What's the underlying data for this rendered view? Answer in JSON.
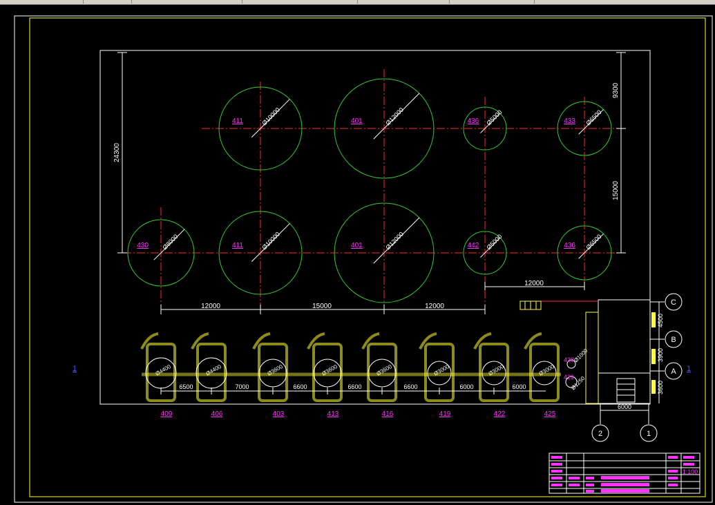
{
  "colors": {
    "background": "#000000",
    "frame": "#ffffff",
    "tank": "#33cc33",
    "centerline": "#ff2a2a",
    "label": "#ff33ff",
    "dimension": "#ffffff",
    "pipe": "#ffff33",
    "stair": "#ffff33"
  },
  "tanks": [
    {
      "tag": "411",
      "dia": "Ø10000"
    },
    {
      "tag": "401",
      "dia": "Ø12000"
    },
    {
      "tag": "436",
      "dia": "Ø5000"
    },
    {
      "tag": "433",
      "dia": "Ø6500"
    },
    {
      "tag": "430",
      "dia": "Ø8000"
    },
    {
      "tag": "411",
      "dia": "Ø10000"
    },
    {
      "tag": "401",
      "dia": "Ø12000"
    },
    {
      "tag": "442",
      "dia": "Ø5000"
    },
    {
      "tag": "436",
      "dia": "Ø6500"
    }
  ],
  "dimensions": {
    "left_vertical": "24300",
    "right_top": "9300",
    "right_bottom": "15000",
    "right_horizontal": "12000",
    "bottom_row": [
      "12000",
      "15000",
      "12000"
    ],
    "small_row": [
      "6500",
      "7000",
      "6600",
      "6600",
      "6600",
      "6000",
      "6000"
    ],
    "building_vertical": [
      "4500",
      "3900",
      "3600"
    ],
    "building_horizontal": "6000"
  },
  "small_tanks": [
    {
      "tag": "409",
      "dia": "Ø4400"
    },
    {
      "tag": "406",
      "dia": "Ø4400"
    },
    {
      "tag": "403",
      "dia": "Ø3600"
    },
    {
      "tag": "413",
      "dia": "Ø3600"
    },
    {
      "tag": "416",
      "dia": "Ø3600"
    },
    {
      "tag": "419",
      "dia": "Ø3000"
    },
    {
      "tag": "422",
      "dia": "Ø3000"
    },
    {
      "tag": "425",
      "dia": "Ø3000"
    }
  ],
  "pumps": [
    {
      "tag": "428",
      "dia": "Ø1000"
    },
    {
      "tag": "429",
      "dia": "Ø1250"
    }
  ],
  "grid_axes": {
    "rows": [
      "C",
      "B",
      "A"
    ],
    "cols": [
      "2",
      "1"
    ]
  },
  "section_marks": [
    "1",
    "1"
  ],
  "title_block": {
    "scale": "1:100"
  }
}
